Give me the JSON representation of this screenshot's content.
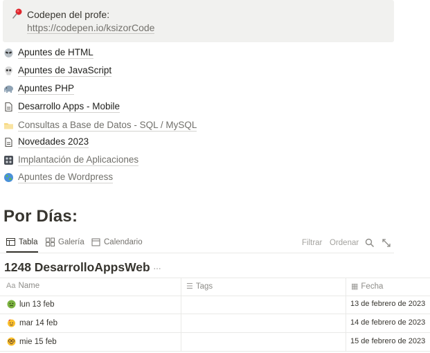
{
  "callout": {
    "icon": "pushpin-icon",
    "title": "Codepen del profe:",
    "url": "https://codepen.io/ksizorCode"
  },
  "links": [
    {
      "icon": "alien-icon",
      "label": "Apuntes de HTML",
      "tone": "dark"
    },
    {
      "icon": "skull-icon",
      "label": "Apuntes de JavaScript",
      "tone": "dark"
    },
    {
      "icon": "elephant-icon",
      "label": "Apuntes PHP",
      "tone": "dark"
    },
    {
      "icon": "page-icon",
      "label": "Desarrollo Apps - Mobile",
      "tone": "dark"
    },
    {
      "icon": "folder-icon",
      "label": "Consultas a Base de Datos - SQL / MySQL",
      "tone": "grey"
    },
    {
      "icon": "page-icon",
      "label": "Novedades 2023",
      "tone": "dark"
    },
    {
      "icon": "control-knobs-icon",
      "label": "Implantación de Aplicaciones",
      "tone": "grey"
    },
    {
      "icon": "globe-icon",
      "label": "Apuntes de Wordpress",
      "tone": "grey"
    }
  ],
  "section_heading": "Por Días:",
  "views": {
    "tabs": [
      {
        "icon": "table-icon",
        "label": "Tabla",
        "active": true
      },
      {
        "icon": "gallery-icon",
        "label": "Galería",
        "active": false
      },
      {
        "icon": "calendar-icon",
        "label": "Calendario",
        "active": false
      }
    ],
    "filter_label": "Filtrar",
    "sort_label": "Ordenar"
  },
  "database": {
    "title": "1248 DesarrolloAppsWeb",
    "more": "···",
    "columns": [
      {
        "icon_text": "Aa",
        "label": "Name"
      },
      {
        "icon_text": "☰",
        "label": "Tags"
      },
      {
        "icon_text": "▦",
        "label": "Fecha"
      }
    ],
    "rows": [
      {
        "emoji": "sick-face-icon",
        "name": "lun 13 feb",
        "tags": "",
        "date": "13 de febrero de 2023"
      },
      {
        "emoji": "party-face-icon",
        "name": "mar 14 feb",
        "tags": "",
        "date": "14 de febrero de 2023"
      },
      {
        "emoji": "nerd-face-icon",
        "name": "mie 15 feb",
        "tags": "",
        "date": "15 de febrero de 2023"
      }
    ]
  },
  "colors": {
    "callout_bg": "#f1f1ef",
    "text": "#37352f",
    "muted": "#73716c"
  }
}
